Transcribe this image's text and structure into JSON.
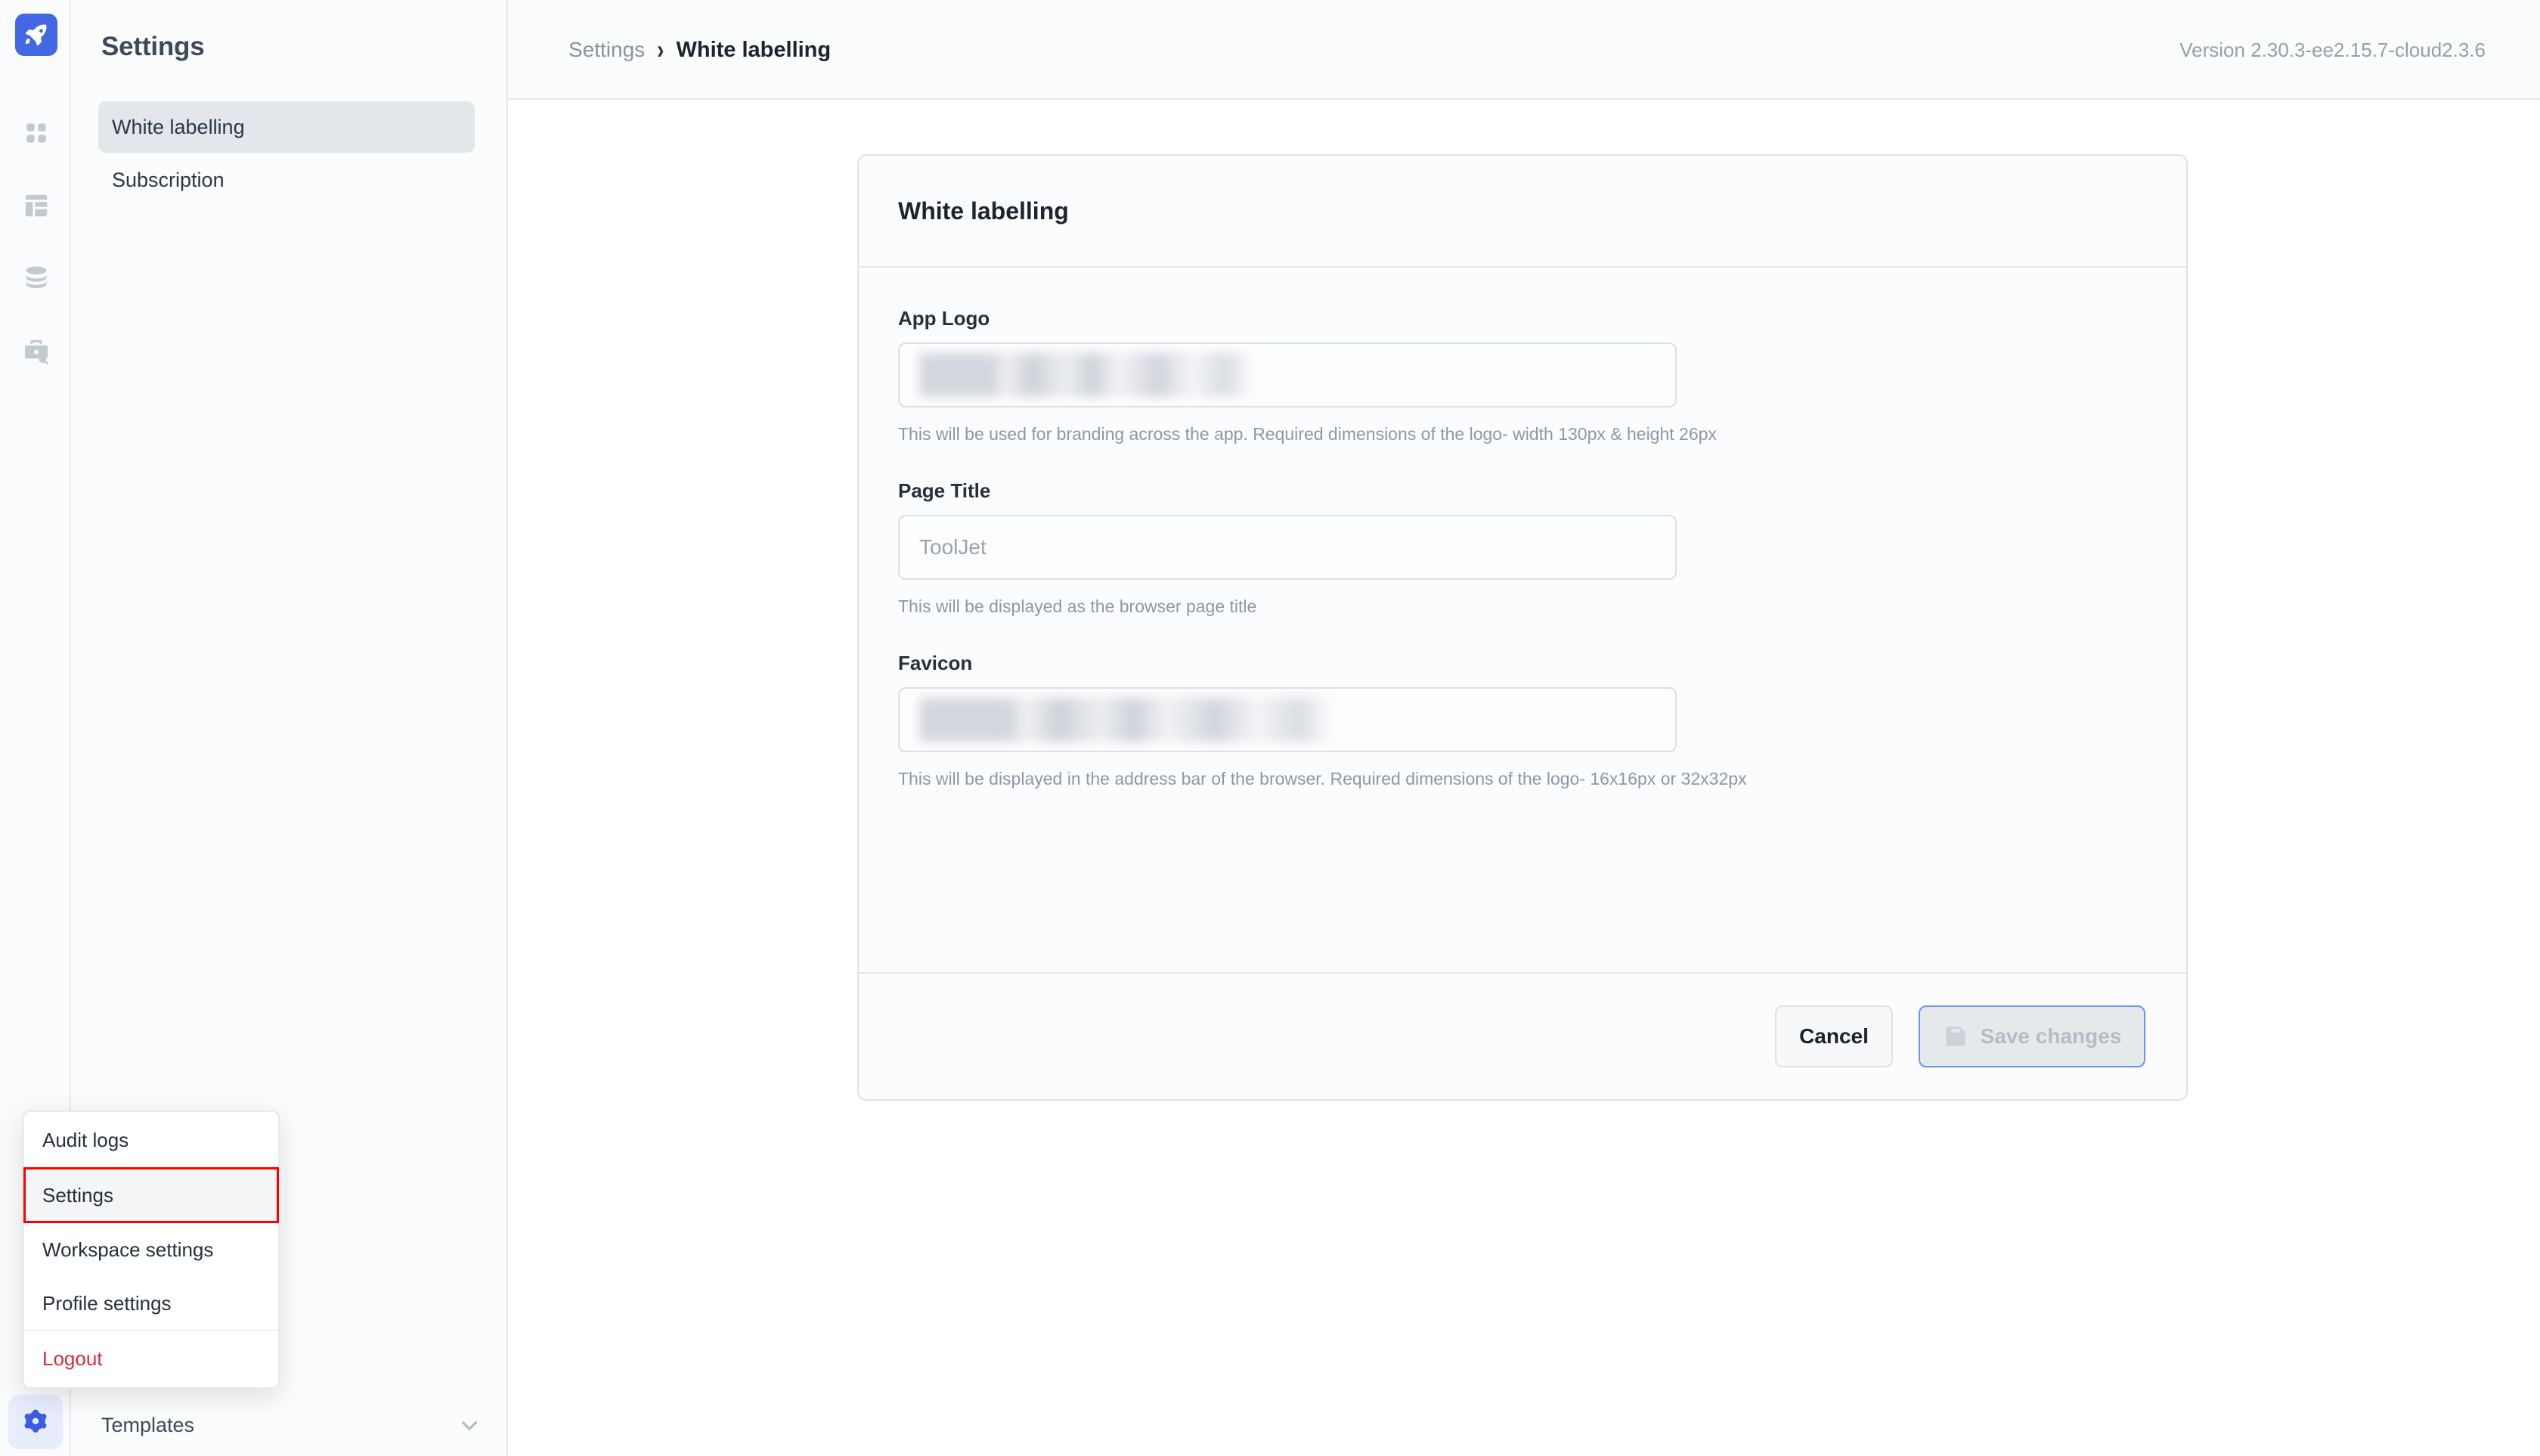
{
  "rail": {
    "logo_icon": "rocket-icon",
    "items": [
      {
        "icon": "apps-grid-icon"
      },
      {
        "icon": "dashboard-layout-icon"
      },
      {
        "icon": "database-icon"
      },
      {
        "icon": "workspace-constants-icon"
      }
    ],
    "gear_icon": "gear-icon"
  },
  "sidebar": {
    "title": "Settings",
    "items": [
      {
        "label": "White labelling",
        "active": true
      },
      {
        "label": "Subscription",
        "active": false
      }
    ]
  },
  "header": {
    "breadcrumb_root": "Settings",
    "breadcrumb_separator": "›",
    "breadcrumb_current": "White labelling",
    "version": "Version 2.30.3-ee2.15.7-cloud2.3.6"
  },
  "card": {
    "title": "White labelling",
    "fields": [
      {
        "label": "App Logo",
        "value": "",
        "placeholder": "",
        "redacted": true,
        "help": "This will be used for branding across the app. Required dimensions of the logo- width 130px & height 26px"
      },
      {
        "label": "Page Title",
        "value": "",
        "placeholder": "ToolJet",
        "redacted": false,
        "help": "This will be displayed as the browser page title"
      },
      {
        "label": "Favicon",
        "value": "",
        "placeholder": "",
        "redacted": true,
        "help": "This will be displayed in the address bar of the browser. Required dimensions of the logo- 16x16px or 32x32px"
      }
    ],
    "footer": {
      "cancel_label": "Cancel",
      "save_label": "Save changes",
      "save_icon": "save-disk-icon",
      "save_disabled": true
    }
  },
  "popup_menu": {
    "items": [
      {
        "label": "Audit logs",
        "highlighted": false,
        "danger": false
      },
      {
        "label": "Settings",
        "highlighted": true,
        "danger": false
      },
      {
        "label": "Workspace settings",
        "highlighted": false,
        "danger": false
      },
      {
        "label": "Profile settings",
        "highlighted": false,
        "danger": false
      },
      {
        "label": "Logout",
        "highlighted": false,
        "danger": true
      }
    ]
  },
  "templates_bar": {
    "label": "Templates",
    "chevron_icon": "chevron-down-icon"
  },
  "colors": {
    "brand_blue": "#4368e3",
    "gear_blue": "#3b5ce0",
    "gear_bg": "#e8edfd",
    "active_item_bg": "#e3e7eb",
    "highlight_red": "#ff0000",
    "danger_red": "#e0293b",
    "save_border_blue": "#6a94f0",
    "muted_text": "#8d98a4"
  }
}
